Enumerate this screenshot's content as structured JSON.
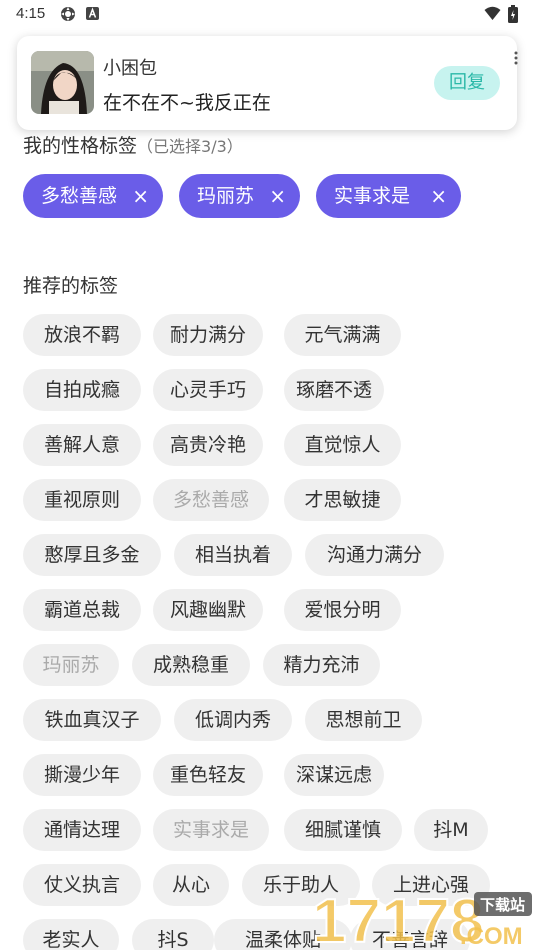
{
  "status_bar": {
    "time": "4:15",
    "icons": [
      "settings-gear-icon",
      "a-badge-icon",
      "wifi-icon",
      "battery-icon"
    ]
  },
  "notification": {
    "sender": "小困包",
    "message": "在不在不~我反正在",
    "reply_label": "回复"
  },
  "my_tags": {
    "title": "我的性格标签",
    "hint": "（已选择3/3）",
    "selected": [
      "多愁善感",
      "玛丽苏",
      "实事求是"
    ],
    "remove_glyph": "×"
  },
  "recommended": {
    "title": "推荐的标签",
    "tags": [
      {
        "label": "放浪不羁",
        "selected": false
      },
      {
        "label": "耐力满分",
        "selected": false
      },
      {
        "label": "元气满满",
        "selected": false
      },
      {
        "label": "自拍成瘾",
        "selected": false
      },
      {
        "label": "心灵手巧",
        "selected": false
      },
      {
        "label": "琢磨不透",
        "selected": false
      },
      {
        "label": "善解人意",
        "selected": false
      },
      {
        "label": "高贵冷艳",
        "selected": false
      },
      {
        "label": "直觉惊人",
        "selected": false
      },
      {
        "label": "重视原则",
        "selected": false
      },
      {
        "label": "多愁善感",
        "selected": true
      },
      {
        "label": "才思敏捷",
        "selected": false
      },
      {
        "label": "憨厚且多金",
        "selected": false
      },
      {
        "label": "相当执着",
        "selected": false
      },
      {
        "label": "沟通力满分",
        "selected": false
      },
      {
        "label": "霸道总裁",
        "selected": false
      },
      {
        "label": "风趣幽默",
        "selected": false
      },
      {
        "label": "爱恨分明",
        "selected": false
      },
      {
        "label": "玛丽苏",
        "selected": true
      },
      {
        "label": "成熟稳重",
        "selected": false
      },
      {
        "label": "精力充沛",
        "selected": false
      },
      {
        "label": "铁血真汉子",
        "selected": false
      },
      {
        "label": "低调内秀",
        "selected": false
      },
      {
        "label": "思想前卫",
        "selected": false
      },
      {
        "label": "撕漫少年",
        "selected": false
      },
      {
        "label": "重色轻友",
        "selected": false
      },
      {
        "label": "深谋远虑",
        "selected": false
      },
      {
        "label": "通情达理",
        "selected": false
      },
      {
        "label": "实事求是",
        "selected": true
      },
      {
        "label": "细腻谨慎",
        "selected": false
      },
      {
        "label": "抖M",
        "selected": false
      },
      {
        "label": "仗义执言",
        "selected": false
      },
      {
        "label": "从心",
        "selected": false
      },
      {
        "label": "乐于助人",
        "selected": false
      },
      {
        "label": "上进心强",
        "selected": false
      },
      {
        "label": "老实人",
        "selected": false
      },
      {
        "label": "抖S",
        "selected": false
      },
      {
        "label": "温柔体贴",
        "selected": false
      },
      {
        "label": "不善言辞",
        "selected": false
      }
    ]
  },
  "watermark": {
    "text": "17178",
    "suffix": ".COM",
    "badge": "下载站"
  }
}
